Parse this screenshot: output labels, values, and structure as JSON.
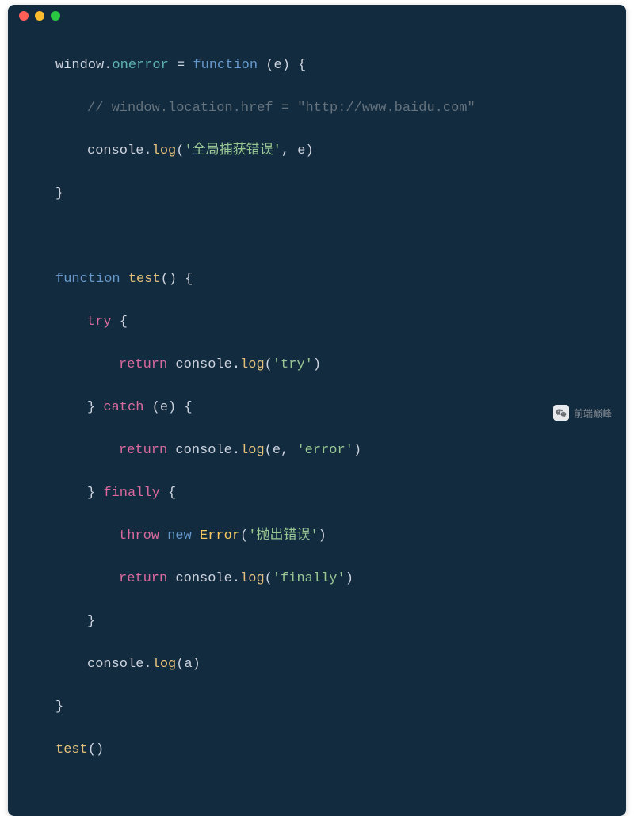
{
  "window": {
    "traffic_light_colors": [
      "#ff5f57",
      "#febc2e",
      "#28c840"
    ]
  },
  "code": {
    "l1": {
      "window": "window",
      "dot1": ".",
      "onerror": "onerror",
      "sp_eq": " = ",
      "function": "function",
      "sp1": " ",
      "open": "(",
      "e": "e",
      "close": ") {"
    },
    "l2": {
      "comment": "// window.location.href = \"http://www.baidu.com\""
    },
    "l3": {
      "console": "console",
      "dot": ".",
      "log": "log",
      "open": "(",
      "str": "'全局捕获错误'",
      "comma": ", ",
      "e": "e",
      "close": ")"
    },
    "l4": {
      "close_brace": "}"
    },
    "l5": {
      "blank": ""
    },
    "l6": {
      "function": "function",
      "sp": " ",
      "name": "test",
      "parens": "() {"
    },
    "l7": {
      "try": "try",
      "brace": " {"
    },
    "l8": {
      "return": "return",
      "sp": " ",
      "console": "console",
      "dot": ".",
      "log": "log",
      "open": "(",
      "str": "'try'",
      "close": ")"
    },
    "l9": {
      "close": "}",
      "sp": " ",
      "catch": "catch",
      "sp2": " (",
      "e": "e",
      "rest": ") {"
    },
    "l10": {
      "return": "return",
      "sp": " ",
      "console": "console",
      "dot": ".",
      "log": "log",
      "open": "(",
      "e": "e",
      "comma": ", ",
      "str": "'error'",
      "close": ")"
    },
    "l11": {
      "close": "}",
      "sp": " ",
      "finally": "finally",
      "brace": " {"
    },
    "l12": {
      "throw": "throw",
      "sp": " ",
      "new": "new",
      "sp2": " ",
      "error": "Error",
      "open": "(",
      "str": "'抛出错误'",
      "close": ")"
    },
    "l13": {
      "return": "return",
      "sp": " ",
      "console": "console",
      "dot": ".",
      "log": "log",
      "open": "(",
      "str": "'finally'",
      "close": ")"
    },
    "l14": {
      "close": "}"
    },
    "l15": {
      "console": "console",
      "dot": ".",
      "log": "log",
      "open": "(",
      "a": "a",
      "close": ")"
    },
    "l16": {
      "close_brace": "}"
    },
    "l17": {
      "name": "test",
      "parens": "()"
    }
  },
  "watermark": {
    "text": "前端巅峰"
  }
}
